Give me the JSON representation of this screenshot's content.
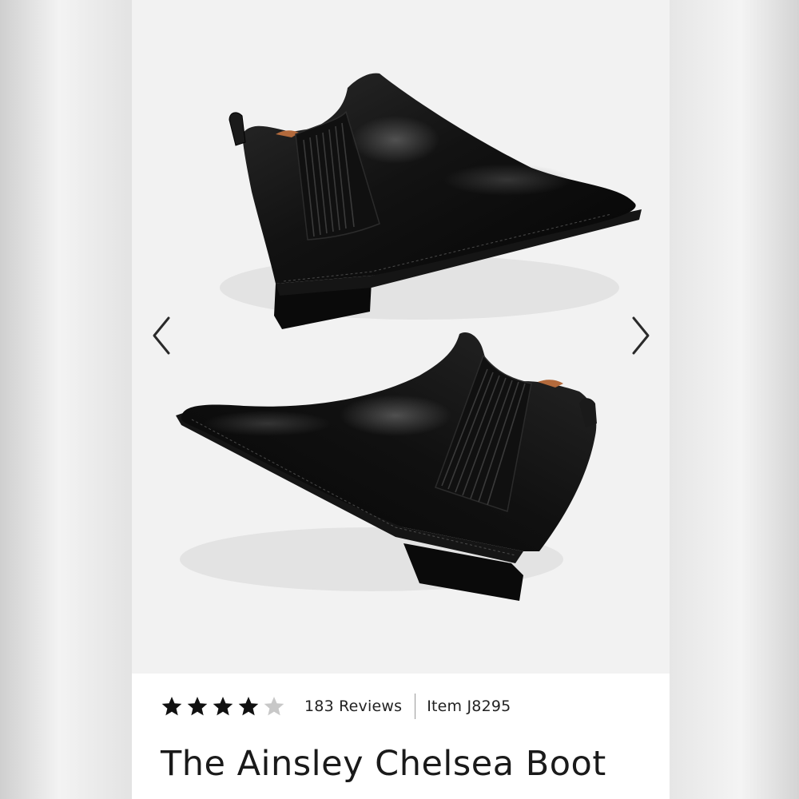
{
  "product": {
    "title": "The Ainsley Chelsea Boot",
    "rating": 4,
    "rating_max": 5,
    "reviews_label": "183 Reviews",
    "item_label": "Item J8295"
  },
  "carousel": {
    "prev_icon": "chevron-left-icon",
    "next_icon": "chevron-right-icon"
  },
  "colors": {
    "star_filled": "#111111",
    "star_empty": "#c8c8c8",
    "image_background": "#f2f2f2"
  }
}
